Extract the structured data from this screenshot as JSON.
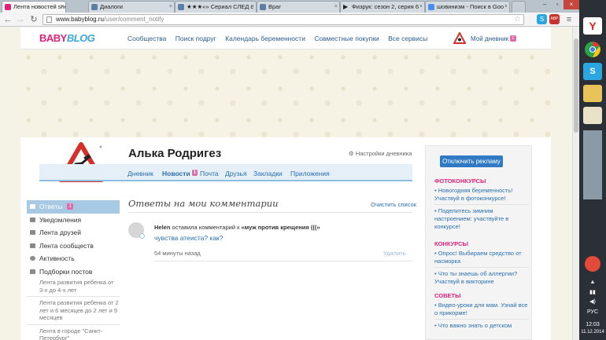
{
  "browser": {
    "tabs": [
      {
        "label": "Лента новостей snejastik",
        "color": "#e0217a",
        "active": true
      },
      {
        "label": "Диалоги",
        "color": "#5b7fa6",
        "active": false
      },
      {
        "label": "★★★«» Сериал СЛЕД с",
        "color": "#5b7fa6",
        "active": false
      },
      {
        "label": "Враг",
        "color": "#5b7fa6",
        "active": false
      },
      {
        "label": "Физрук: сезон 2, серия 6",
        "color": "#222222",
        "active": false
      },
      {
        "label": "шовинизм - Поиск в Goo",
        "color": "#4a8cf0",
        "active": false
      }
    ],
    "url_host": "www.babyblog.ru",
    "url_path": "/user/comment_notify",
    "ext_s": "S",
    "ext_abp": "ABP"
  },
  "site": {
    "logo_a": "BABY",
    "logo_b": "BLOG",
    "nav": [
      "Сообщества",
      "Поиск подруг",
      "Календарь беременности",
      "Совместные покупки",
      "Все сервисы"
    ],
    "my_diary": "Мой дневник",
    "my_diary_badge": "1"
  },
  "profile": {
    "name": "Алька Родригез",
    "settings": "Настройки дневника",
    "tabs": [
      {
        "label": "Дневник"
      },
      {
        "label": "Новости",
        "badge": "1"
      },
      {
        "label": "Почта"
      },
      {
        "label": "Друзья"
      },
      {
        "label": "Закладки"
      },
      {
        "label": "Приложения"
      }
    ]
  },
  "leftmenu": {
    "items": [
      {
        "label": "Ответы",
        "badge": "1"
      },
      {
        "label": "Уведомления"
      },
      {
        "label": "Лента друзей"
      },
      {
        "label": "Лента сообществ"
      },
      {
        "label": "Активность"
      },
      {
        "label": "Подборки постов"
      }
    ],
    "subs": [
      "Лента развития ребенка от 3-х до 4-х лет",
      "Лента развития ребенка от 2 лет и 6 месяцев до 2 лет и 9 месяцев",
      "Лента в городе \"Санкт-Петербург\""
    ]
  },
  "main": {
    "title": "Ответы на мои комментарии",
    "clear": "Очистить список",
    "comment": {
      "author": "Helen",
      "action": "оставила комментарий к",
      "post": "«муж против крещения (((»",
      "text": "чувства атеиста? как?",
      "time": "54 минуты назад",
      "delete": "Удалить"
    }
  },
  "right": {
    "noads": "Отключить рекламу",
    "sections": [
      {
        "head": "ФОТОКОНКУРСЫ",
        "links": [
          "• Новогодняя беременность! Участвуй в фотоконкурсе!",
          "• Поделитесь зимним настроением: участвуйте в конкурсе!"
        ]
      },
      {
        "head": "КОНКУРСЫ",
        "links": [
          "• Опрос! Выбираем средство от насморка",
          "• Что ты знаешь об аллергии? Участвуй в викторине"
        ]
      },
      {
        "head": "СОВЕТЫ",
        "links": [
          "• Видео-уроки для мам. Узнай все о прикорме!",
          "• Что важно знать о детском"
        ]
      }
    ]
  },
  "taskbar": {
    "lang": "РУС",
    "time": "12:03",
    "date": "11.12.2014"
  }
}
